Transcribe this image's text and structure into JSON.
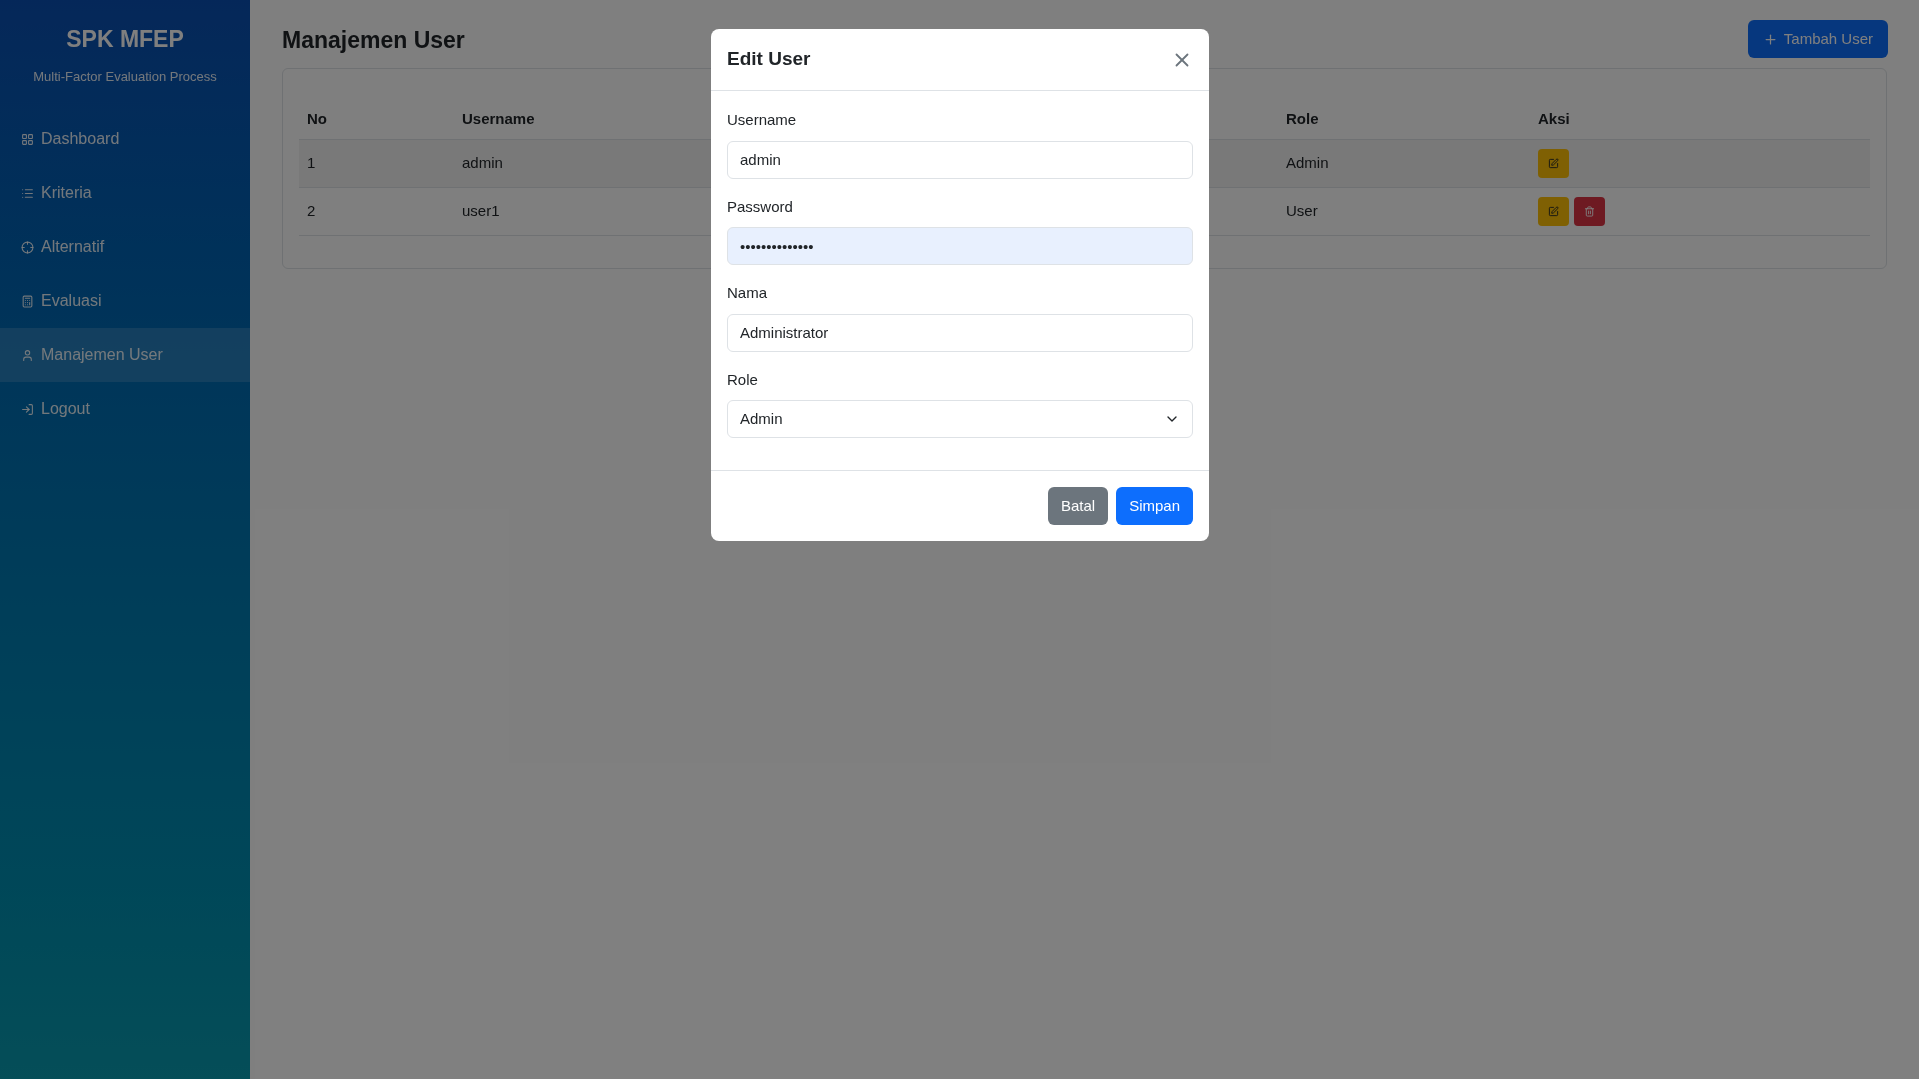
{
  "sidebar": {
    "title": "SPK MFEP",
    "subtitle": "Multi-Factor Evaluation Process",
    "items": [
      {
        "kind": "grid",
        "label": "Dashboard",
        "selected": false
      },
      {
        "kind": "list",
        "label": "Kriteria",
        "selected": false
      },
      {
        "kind": "target",
        "label": "Alternatif",
        "selected": false
      },
      {
        "kind": "calculator",
        "label": "Evaluasi",
        "selected": false
      },
      {
        "kind": "user",
        "label": "Manajemen User",
        "selected": true
      },
      {
        "kind": "logout",
        "label": "Logout",
        "selected": false
      }
    ]
  },
  "page": {
    "title": "Manajemen User",
    "add_button": "Tambah User"
  },
  "table": {
    "columns": [
      "No",
      "Username",
      "Role",
      "Aksi"
    ],
    "rows": [
      {
        "no": "1",
        "username": "admin",
        "role": "Admin",
        "deletable": false
      },
      {
        "no": "2",
        "username": "user1",
        "role": "User",
        "deletable": true
      }
    ]
  },
  "modal": {
    "title": "Edit User",
    "fields": [
      {
        "kind": "text",
        "label": "Username",
        "value": "admin"
      },
      {
        "kind": "password",
        "label": "Password",
        "value": "••••••••••••••"
      },
      {
        "kind": "text",
        "label": "Nama",
        "value": "Administrator"
      },
      {
        "kind": "select",
        "label": "Role",
        "value": "Admin"
      }
    ],
    "buttons": [
      "Batal",
      "Simpan"
    ]
  }
}
